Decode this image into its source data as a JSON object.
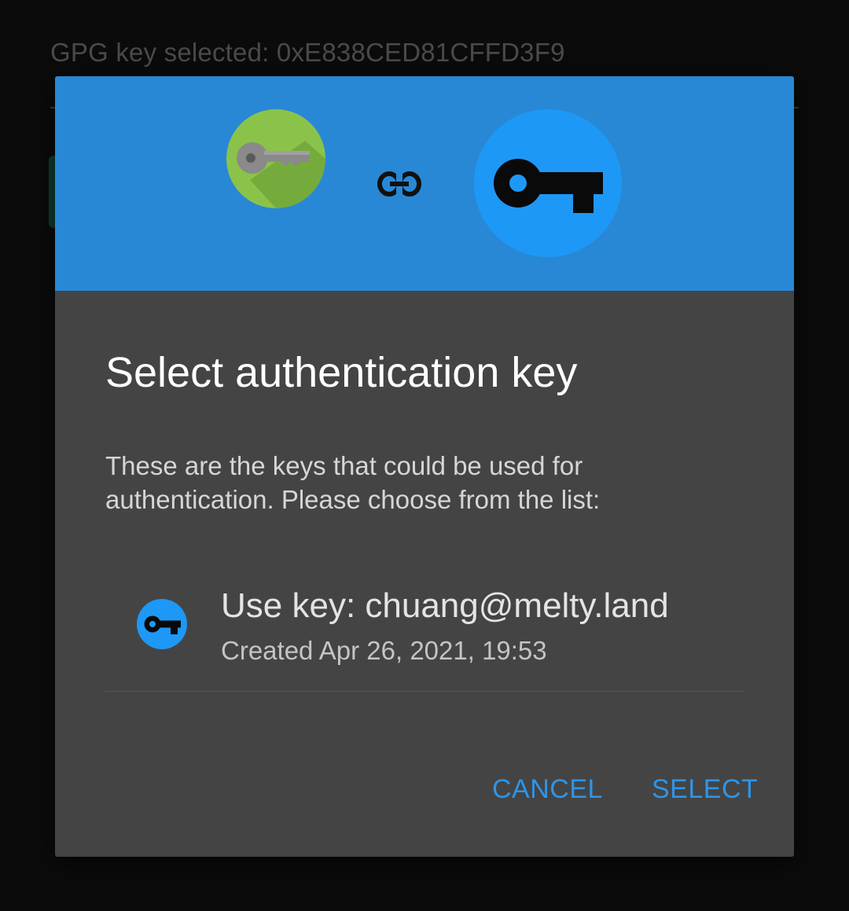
{
  "background": {
    "gpg_label": "GPG key selected: 0xE838CED81CFFD3F9"
  },
  "dialog": {
    "header": {
      "app_icon": "openkeychain-key-icon",
      "link_icon": "link-icon",
      "site_icon": "key-icon",
      "header_color": "#2888d6"
    },
    "title": "Select authentication key",
    "message": "These are the keys that could be used for authentication. Please choose from the list:",
    "keys": [
      {
        "icon": "key-icon",
        "label": "Use key: chuang@melty.land",
        "created": "Created Apr 26, 2021, 19:53"
      }
    ],
    "buttons": {
      "cancel": "CANCEL",
      "select": "SELECT"
    },
    "accent_color": "#2e95e8"
  }
}
